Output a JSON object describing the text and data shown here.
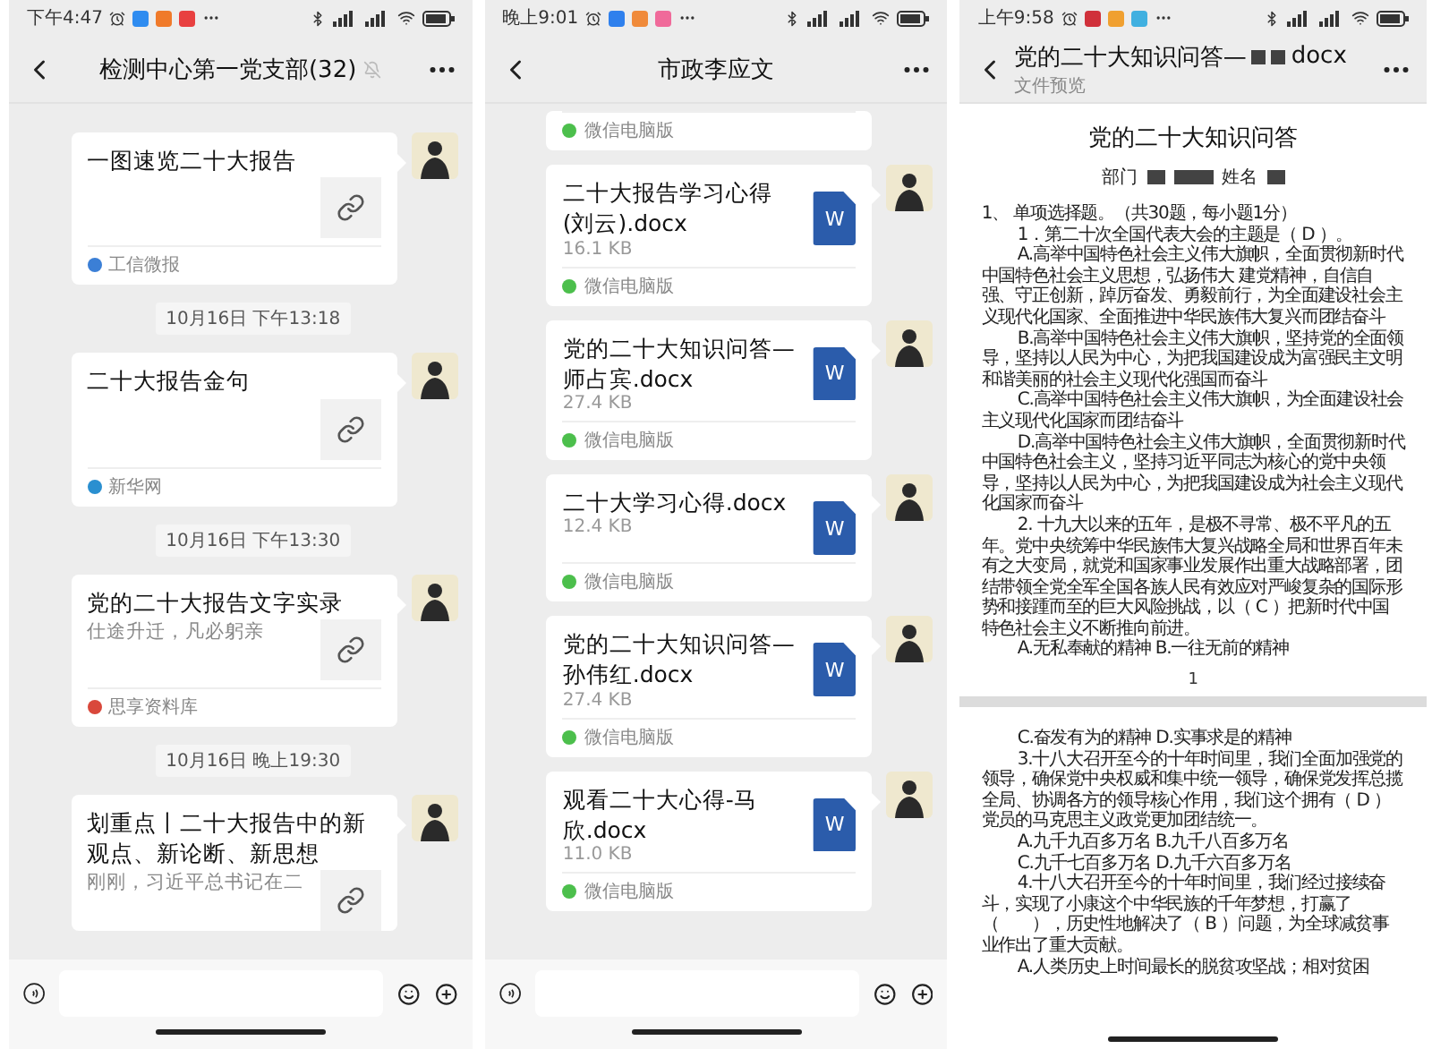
{
  "phones": [
    {
      "kind": "chat",
      "status": {
        "time": "下午4:47",
        "apps": [
          {
            "color": "#2f8cf0"
          },
          {
            "color": "#f07a2a"
          },
          {
            "color": "#e84040"
          }
        ]
      },
      "header": {
        "title": "检测中心第一党支部(32)",
        "muted": true
      },
      "messages": [
        {
          "kind": "link",
          "title": "一图速览二十大报告",
          "source": "工信微报",
          "color": "#3b7fd6"
        },
        {
          "kind": "time",
          "text": "10月16日 下午13:18"
        },
        {
          "kind": "link",
          "title": "二十大报告金句",
          "source": "新华网",
          "color": "#2a8fd0"
        },
        {
          "kind": "time",
          "text": "10月16日 下午13:30"
        },
        {
          "kind": "link",
          "title": "党的二十大报告文字实录",
          "desc": "仕途升迁，凡必躬亲",
          "source": "思享资料库",
          "color": "#d9483b"
        },
        {
          "kind": "time",
          "text": "10月16日 晚上19:30"
        },
        {
          "kind": "link",
          "title": "划重点丨二十大报告中的新观点、新论断、新思想",
          "desc": "刚刚，习近平总书记在二"
        }
      ]
    },
    {
      "kind": "chat",
      "status": {
        "time": "晚上9:01",
        "apps": [
          {
            "color": "#2f80ed"
          },
          {
            "color": "#f08a3a"
          },
          {
            "color": "#f06a9a"
          }
        ]
      },
      "header": {
        "title": "市政李应文",
        "muted": false
      },
      "messages": [
        {
          "kind": "file_tail",
          "source": "微信电脑版"
        },
        {
          "kind": "file",
          "name": "二十大报告学习心得(刘云).docx",
          "size": "16.1 KB",
          "icon": "W",
          "source": "微信电脑版"
        },
        {
          "kind": "file",
          "name": "党的二十大知识问答—师占宾.docx",
          "size": "27.4 KB",
          "icon": "W",
          "source": "微信电脑版"
        },
        {
          "kind": "file",
          "name": "二十大学习心得.docx",
          "size": "12.4 KB",
          "icon": "W",
          "source": "微信电脑版"
        },
        {
          "kind": "file",
          "name": "党的二十大知识问答—孙伟红.docx",
          "size": "27.4 KB",
          "icon": "W",
          "source": "微信电脑版"
        },
        {
          "kind": "file",
          "name": "观看二十大心得-马欣.docx",
          "size": "11.0 KB",
          "icon": "W",
          "source": "微信电脑版"
        }
      ]
    },
    {
      "kind": "preview",
      "status": {
        "time": "上午9:58",
        "apps": [
          {
            "color": "#d0303a"
          },
          {
            "color": "#f0a030"
          },
          {
            "color": "#40b0e0"
          }
        ]
      },
      "header": {
        "title_parts": [
          {
            "kind": "text",
            "text": "党的二十大知识问答—"
          },
          {
            "kind": "redaction"
          },
          {
            "kind": "redaction"
          },
          {
            "kind": "text",
            "text": "docx"
          }
        ],
        "subtitle": "文件预览"
      },
      "pages": [
        {
          "title": "党的二十大知识问答",
          "fields": [
            {
              "kind": "text",
              "text": "部门"
            },
            {
              "kind": "redaction"
            },
            {
              "kind": "redaction"
            },
            {
              "kind": "text",
              "text": "姓名"
            },
            {
              "kind": "redaction"
            }
          ],
          "paragraphs": [
            {
              "kind": "section",
              "text": "1、 单项选择题。（共30题，每小题1分）"
            },
            {
              "kind": "indent",
              "text": "1．第二十次全国代表大会的主题是（ D ）。"
            },
            {
              "kind": "indent",
              "text": "A.高举中国特色社会主义伟大旗帜，全面贯彻新时代中国特色社会主义思想，弘扬伟大 建党精神，自信自强、守正创新，踔厉奋发、勇毅前行，为全面建设社会主义现代化国家、全面推进中华民族伟大复兴而团结奋斗"
            },
            {
              "kind": "indent",
              "text": "B.高举中国特色社会主义伟大旗帜，坚持党的全面领导，坚持以人民为中心，为把我国建设成为富强民主文明和谐美丽的社会主义现代化强国而奋斗"
            },
            {
              "kind": "indent",
              "text": "C.高举中国特色社会主义伟大旗帜，为全面建设社会主义现代化国家而团结奋斗"
            },
            {
              "kind": "indent",
              "text": "D.高举中国特色社会主义伟大旗帜，全面贯彻新时代中国特色社会主义，坚持习近平同志为核心的党中央领导，坚持以人民为中心，为把我国建设成为社会主义现代化国家而奋斗"
            },
            {
              "kind": "indent",
              "text": "2. 十九大以来的五年，是极不寻常、极不平凡的五年。党中央统筹中华民族伟大复兴战略全局和世界百年未有之大变局，就党和国家事业发展作出重大战略部署，团结带领全党全军全国各族人民有效应对严峻复杂的国际形势和接踵而至的巨大风险挑战，以（ C ）把新时代中国特色社会主义不断推向前进。"
            },
            {
              "kind": "indent",
              "text": "A.无私奉献的精神 B.一往无前的精神"
            }
          ],
          "page_number": "1"
        },
        {
          "paragraphs": [
            {
              "kind": "indent",
              "text": "C.奋发有为的精神 D.实事求是的精神"
            },
            {
              "kind": "indent",
              "text": "3.十八大召开至今的十年时间里，我们全面加强党的领导，确保党中央权威和集中统一领导，确保党发挥总揽全局、协调各方的领导核心作用，我们这个拥有（ D ）党员的马克思主义政党更加团结统一。"
            },
            {
              "kind": "indent",
              "text": "A.九千九百多万名 B.九千八百多万名"
            },
            {
              "kind": "indent",
              "text": "C.九千七百多万名 D.九千六百多万名"
            },
            {
              "kind": "indent",
              "text": "4.十八大召开至今的十年时间里，我们经过接续奋斗，实现了小康这个中华民族的千年梦想，打赢了（　　），历史性地解决了（ B ）问题，为全球减贫事业作出了重大贡献。"
            },
            {
              "kind": "indent",
              "text": "A.人类历史上时间最长的脱贫攻坚战；相对贫困"
            }
          ]
        }
      ]
    }
  ]
}
